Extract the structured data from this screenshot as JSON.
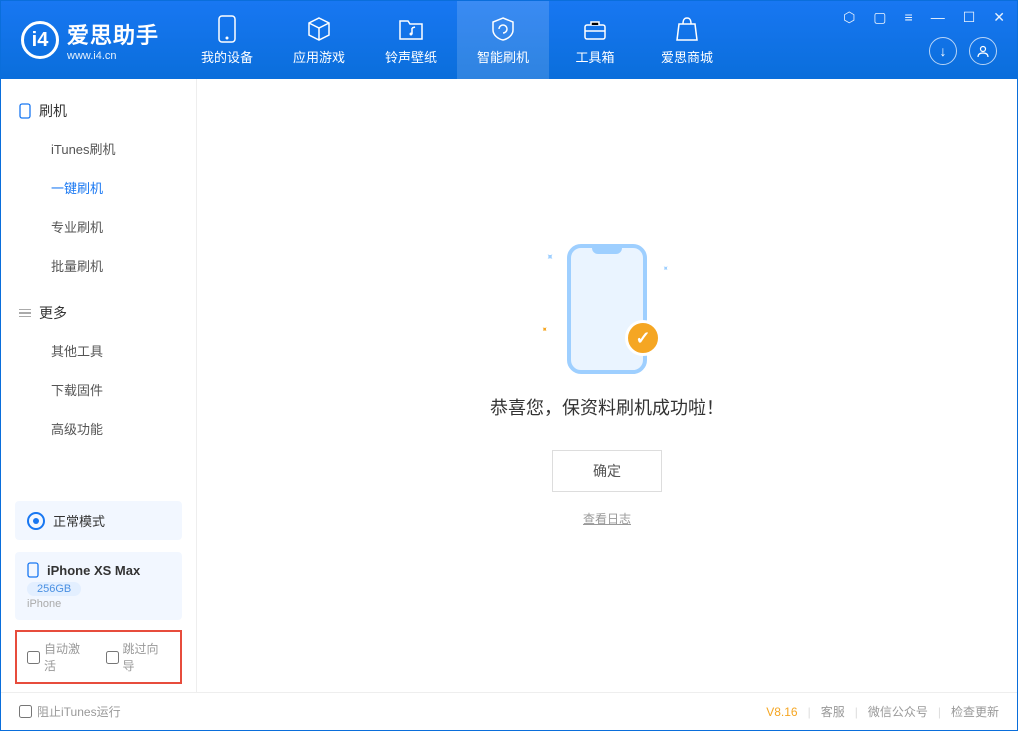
{
  "app": {
    "name": "爱思助手",
    "url": "www.i4.cn"
  },
  "tabs": [
    {
      "label": "我的设备"
    },
    {
      "label": "应用游戏"
    },
    {
      "label": "铃声壁纸"
    },
    {
      "label": "智能刷机"
    },
    {
      "label": "工具箱"
    },
    {
      "label": "爱思商城"
    }
  ],
  "sidebar": {
    "group1_title": "刷机",
    "group1_items": [
      "iTunes刷机",
      "一键刷机",
      "专业刷机",
      "批量刷机"
    ],
    "group2_title": "更多",
    "group2_items": [
      "其他工具",
      "下载固件",
      "高级功能"
    ]
  },
  "mode": {
    "label": "正常模式"
  },
  "device": {
    "name": "iPhone XS Max",
    "storage": "256GB",
    "type": "iPhone"
  },
  "options": {
    "auto_activate": "自动激活",
    "skip_guide": "跳过向导"
  },
  "main": {
    "success_title": "恭喜您，保资料刷机成功啦！",
    "confirm": "确定",
    "view_log": "查看日志"
  },
  "footer": {
    "block_itunes": "阻止iTunes运行",
    "version": "V8.16",
    "links": [
      "客服",
      "微信公众号",
      "检查更新"
    ]
  }
}
